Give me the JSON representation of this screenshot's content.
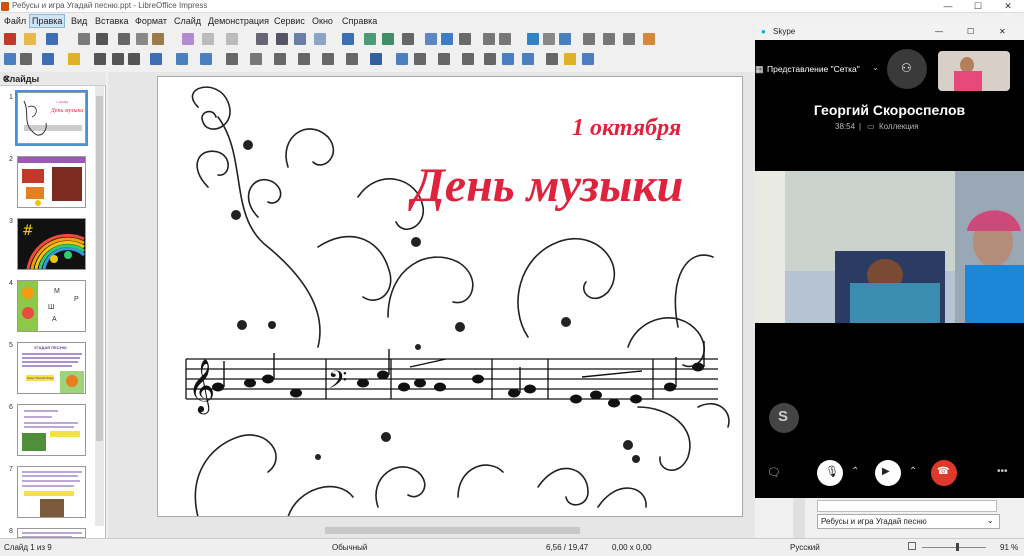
{
  "window": {
    "title": "Ребусы и игра Угадай песню.ppt - LibreOffice Impress",
    "min": "—",
    "max": "☐",
    "close": "✕"
  },
  "menu": [
    "Файл",
    "Правка",
    "Вид",
    "Вставка",
    "Формат",
    "Слайд",
    "Демонстрация",
    "Сервис",
    "Окно",
    "Справка"
  ],
  "slides_panel": {
    "title": "Слайды",
    "close": "✕",
    "numbers": [
      "1",
      "2",
      "3",
      "4",
      "5",
      "6",
      "7",
      "8"
    ]
  },
  "thumbs": {
    "t1": "День музыки",
    "t4": [
      "М",
      "Р",
      "Ш",
      "А"
    ],
    "t5_title": "УГАДАЙ ПЕСНЮ",
    "t5_btn": "Песня \"Лесной Олень\""
  },
  "slide": {
    "date": "1 октября",
    "title": "День музыки"
  },
  "status": {
    "slide": "Слайд 1 из 9",
    "layout": "Обычный",
    "pos": "6,56 / 19,47",
    "size": "0,00 x 0,00",
    "lang": "Русский",
    "zoom": "91 %"
  },
  "skype": {
    "app": "Skype",
    "view": "Представление \"Сетка\"",
    "name": "Георгий Скороспелов",
    "time": "38:54",
    "sep": "|",
    "collection": "Коллекция",
    "logo": "S"
  },
  "right_panel": {
    "combo": "Ребусы и игра Угадай песню"
  },
  "colors": {
    "accent": "#e0233c",
    "skype_blue": "#00aff0",
    "hangup": "#e0392b"
  }
}
